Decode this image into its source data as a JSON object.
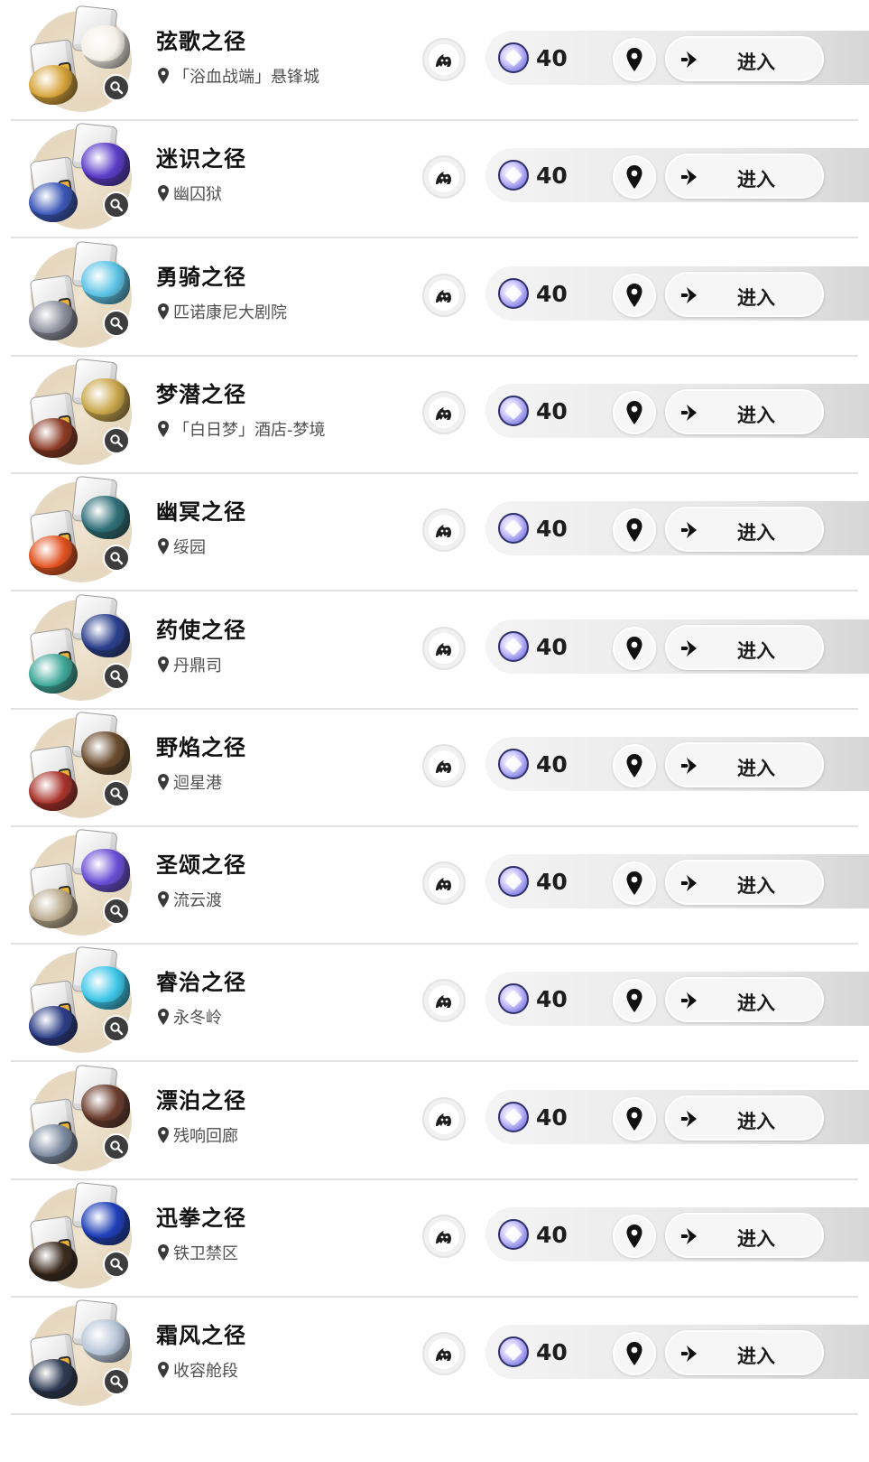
{
  "stamina_icon": "trailblaze-power-icon",
  "enemy_icon": "weekly-boss-icon",
  "colors": {
    "divider": "#e2e2e2",
    "zoom_badge": "#3d3d3d",
    "text": "#111111",
    "bar_gradient_end": "#d6d6d6"
  },
  "rows": [
    {
      "title": "弦歌之径",
      "location": "「浴血战端」悬锋城",
      "cost": "40",
      "enter": "进入",
      "relic_a": "#d7a43a",
      "relic_b": "#f4f0e6"
    },
    {
      "title": "迷识之径",
      "location": "幽囚狱",
      "cost": "40",
      "enter": "进入",
      "relic_a": "#3c57b8",
      "relic_b": "#5a3cc8"
    },
    {
      "title": "勇骑之径",
      "location": "匹诺康尼大剧院",
      "cost": "40",
      "enter": "进入",
      "relic_a": "#8a8f9c",
      "relic_b": "#5cc3e6"
    },
    {
      "title": "梦潜之径",
      "location": "「白日梦」酒店-梦境",
      "cost": "40",
      "enter": "进入",
      "relic_a": "#8b3a24",
      "relic_b": "#c9a64a"
    },
    {
      "title": "幽冥之径",
      "location": "绥园",
      "cost": "40",
      "enter": "进入",
      "relic_a": "#e2521f",
      "relic_b": "#2f6f78"
    },
    {
      "title": "药使之径",
      "location": "丹鼎司",
      "cost": "40",
      "enter": "进入",
      "relic_a": "#3fa89a",
      "relic_b": "#2a3f8c"
    },
    {
      "title": "野焰之径",
      "location": "迴星港",
      "cost": "40",
      "enter": "进入",
      "relic_a": "#a8332b",
      "relic_b": "#6a4c2e"
    },
    {
      "title": "圣颂之径",
      "location": "流云渡",
      "cost": "40",
      "enter": "进入",
      "relic_a": "#b9a98c",
      "relic_b": "#6a4fd6"
    },
    {
      "title": "睿治之径",
      "location": "永冬岭",
      "cost": "40",
      "enter": "进入",
      "relic_a": "#2d3e86",
      "relic_b": "#3cc6e8"
    },
    {
      "title": "漂泊之径",
      "location": "残响回廊",
      "cost": "40",
      "enter": "进入",
      "relic_a": "#7c8aa0",
      "relic_b": "#6b3d2e"
    },
    {
      "title": "迅拳之径",
      "location": "铁卫禁区",
      "cost": "40",
      "enter": "进入",
      "relic_a": "#3b2b1f",
      "relic_b": "#1f3fb8"
    },
    {
      "title": "霜风之径",
      "location": "收容舱段",
      "cost": "40",
      "enter": "进入",
      "relic_a": "#2e3a52",
      "relic_b": "#b8c6d8"
    }
  ]
}
